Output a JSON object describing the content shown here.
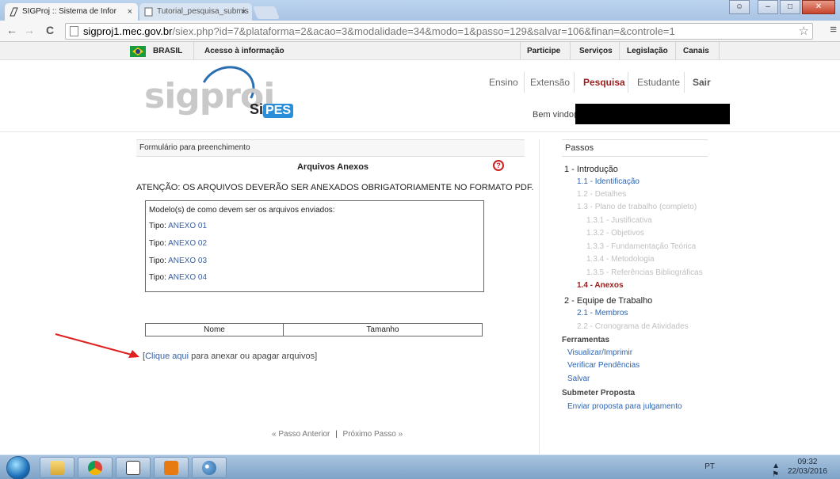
{
  "browser": {
    "tabs": [
      {
        "label": "SIGProj :: Sistema de Infor",
        "close": "×"
      },
      {
        "label": "Tutorial_pesquisa_submis",
        "close": "×"
      }
    ],
    "back": "←",
    "forward": "→",
    "reload": "C",
    "url_host": "sigproj1.mec.gov.br",
    "url_path": "/siex.php?id=7&plataforma=2&acao=3&modalidade=34&modo=1&passo=129&salvar=106&finan=&controle=1",
    "star": "☆",
    "menu": "≡",
    "window_buttons": {
      "minimize": "–",
      "maximize": "□",
      "close": "✕"
    }
  },
  "govbar": {
    "brasil": "BRASIL",
    "acesso": "Acesso à informação",
    "links": [
      "Participe",
      "Serviços",
      "Legislação",
      "Canais"
    ]
  },
  "header": {
    "logo_text": "sigproj",
    "logo_si": "Si",
    "logo_pes": "PES",
    "nav": [
      "Ensino",
      "Extensão",
      "Pesquisa",
      "Estudante",
      "Sair"
    ],
    "welcome": "Bem vindo(a"
  },
  "form": {
    "panel_title": "Formulário para preenchimento",
    "section_title": "Arquivos Anexos",
    "help": "?",
    "attention": "ATENÇÃO: OS ARQUIVOS DEVERÃO SER ANEXADOS OBRIGATORIAMENTE NO FORMATO PDF.",
    "models_header": "Modelo(s) de como devem ser os arquivos enviados:",
    "type_label": "Tipo:",
    "models": [
      "ANEXO 01",
      "ANEXO 02",
      "ANEXO 03",
      "ANEXO 04"
    ],
    "table_headers": [
      "Nome",
      "Tamanho"
    ],
    "attach_open": "[",
    "attach_link": "Clique aqui",
    "attach_rest": " para anexar ou apagar arquivos]",
    "prev_step": "« Passo Anterior",
    "pager_sep": "|",
    "next_step": "Próximo Passo »"
  },
  "sidebar": {
    "title": "Passos",
    "steps": [
      {
        "label": "1 - Introdução",
        "state": "heading"
      },
      {
        "label": "1.1 - Identificação",
        "state": "link"
      },
      {
        "label": "1.2 - Detalhes",
        "state": "disabled"
      },
      {
        "label": "1.3 - Plano de trabalho (completo)",
        "state": "disabled"
      },
      {
        "label": "1.3.1 - Justificativa",
        "state": "disabled"
      },
      {
        "label": "1.3.2 - Objetivos",
        "state": "disabled"
      },
      {
        "label": "1.3.3 - Fundamentação Teórica",
        "state": "disabled"
      },
      {
        "label": "1.3.4 - Metodologia",
        "state": "disabled"
      },
      {
        "label": "1.3.5 - Referências Bibliográficas",
        "state": "disabled"
      },
      {
        "label": "1.4 - Anexos",
        "state": "current"
      },
      {
        "label": "2 - Equipe de Trabalho",
        "state": "heading"
      },
      {
        "label": "2.1 - Membros",
        "state": "link"
      },
      {
        "label": "2.2 - Cronograma de Atividades",
        "state": "disabled"
      }
    ],
    "tools_title": "Ferramentas",
    "tools": [
      "Visualizar/Imprimir",
      "Verificar Pendências",
      "Salvar"
    ],
    "submit_title": "Submeter Proposta",
    "submit_link": "Enviar proposta para julgamento"
  },
  "taskbar": {
    "lang": "PT",
    "tray_icons": "▲ ⚑ ▭ ◖",
    "time": "09:32",
    "date": "22/03/2016"
  },
  "colors": {
    "accent_red": "#9b1c1c",
    "link_blue": "#2a64b4",
    "disabled_gray": "#c0c0c0"
  }
}
